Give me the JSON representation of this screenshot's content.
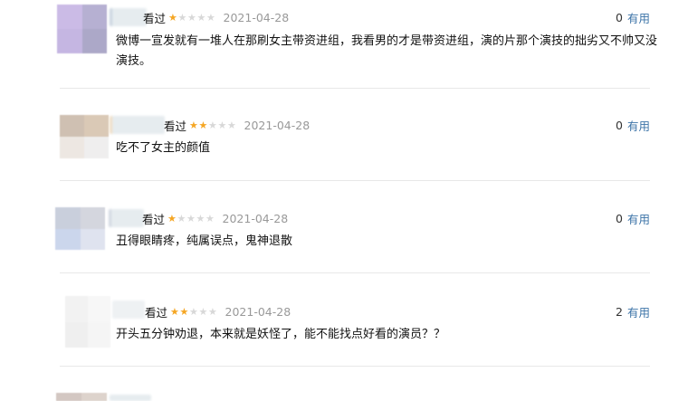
{
  "colors": {
    "star_on": "#f5a623",
    "star_off": "#d8d8d8",
    "date": "#999999",
    "useful_link": "#3d74a8"
  },
  "comments": [
    {
      "status": "看过",
      "rating": 1,
      "rating_max": 5,
      "date": "2021-04-28",
      "votes": "0",
      "useful_label": "有用",
      "text": "微博一宣发就有一堆人在那刷女主带资进组，我看男的才是带资进组，演的片那个演技的拙劣又不帅又没演技。"
    },
    {
      "status": "看过",
      "rating": 2,
      "rating_max": 5,
      "date": "2021-04-28",
      "votes": "0",
      "useful_label": "有用",
      "text": "吃不了女主的颜值"
    },
    {
      "status": "看过",
      "rating": 1,
      "rating_max": 5,
      "date": "2021-04-28",
      "votes": "0",
      "useful_label": "有用",
      "text": "丑得眼睛疼，纯属误点，鬼神退散"
    },
    {
      "status": "看过",
      "rating": 2,
      "rating_max": 5,
      "date": "2021-04-28",
      "votes": "2",
      "useful_label": "有用",
      "text": "开头五分钟劝退，本来就是妖怪了，能不能找点好看的演员？？"
    }
  ]
}
